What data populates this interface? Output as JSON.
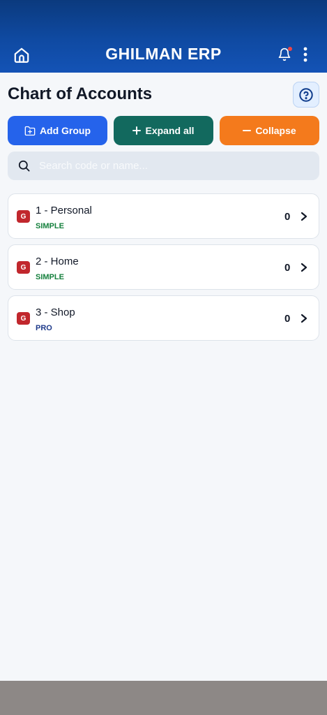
{
  "header": {
    "title": "GHILMAN ERP",
    "home_icon": "home-icon",
    "bell_icon": "bell-icon",
    "more_icon": "more-vertical-icon",
    "colors": {
      "top": "#0b3a7e",
      "bottom": "#1453b6"
    }
  },
  "page": {
    "title": "Chart of Accounts",
    "help_icon": "help-circle-icon"
  },
  "actions": {
    "add_group": "Add Group",
    "expand_all": "Expand all",
    "collapse": "Collapse",
    "colors": {
      "add": "#2563eb",
      "expand": "#12695e",
      "collapse": "#f47a1c"
    }
  },
  "search": {
    "placeholder": "Search code or name...",
    "value": ""
  },
  "accounts": [
    {
      "badge": "G",
      "name": "1 - Personal",
      "type": "SIMPLE",
      "count": "0"
    },
    {
      "badge": "G",
      "name": "2 - Home",
      "type": "SIMPLE",
      "count": "0"
    },
    {
      "badge": "G",
      "name": "3 - Shop",
      "type": "PRO",
      "count": "0"
    }
  ]
}
